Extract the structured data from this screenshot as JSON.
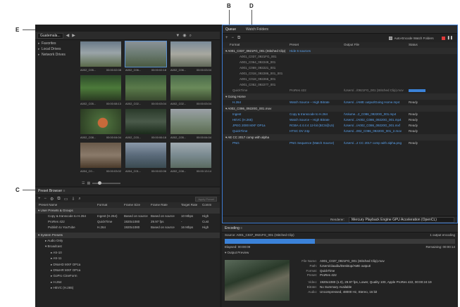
{
  "callouts": {
    "b": "B",
    "c": "C",
    "d": "D",
    "e": "E"
  },
  "media_browser": {
    "location": "Guatemala...",
    "tree": [
      "Favorites",
      "Local Drives",
      "Network Drives"
    ],
    "thumbs": [
      {
        "name": "A002_C05...",
        "tc": "00:00:02:08"
      },
      {
        "name": "A002_C06...",
        "tc": "00:00:02:18",
        "selected": true
      },
      {
        "name": "A002_C06...",
        "tc": "00:00:03:04"
      },
      {
        "name": "A002_C05...",
        "tc": "00:00:08:13"
      },
      {
        "name": "A002_C02...",
        "tc": "00:00:03:04"
      },
      {
        "name": "A002_C02...",
        "tc": "00:00:03:04"
      },
      {
        "name": "A002_C08...",
        "tc": "00:00:04:04"
      },
      {
        "name": "A002_C03...",
        "tc": "00:00:06:18"
      },
      {
        "name": "A002_C05...",
        "tc": "00:00:04:04"
      },
      {
        "name": "A004_C0...",
        "tc": "00:00:03:02"
      },
      {
        "name": "A004_C01...",
        "tc": "00:00:02:06"
      },
      {
        "name": "A002_C08...",
        "tc": "00:00:13:14"
      }
    ]
  },
  "preset_browser": {
    "title": "Preset Browser",
    "apply": "Apply Preset",
    "columns": [
      "Preset Name",
      "Format",
      "Frame Size",
      "Frame Rate",
      "Target Rate",
      "Comm"
    ],
    "user_group": "User Presets & Groups",
    "user_presets": [
      [
        "Copy & transcode to H.264",
        "Ingest (H.264)",
        "Based on source",
        "Based on source",
        "10 Mbps",
        "High"
      ],
      [
        "ProRes 422",
        "QuickTime",
        "1920x1080",
        "29.97 fps",
        "-",
        "Cust"
      ],
      [
        "Publish to YouTube",
        "H.264",
        "1920x1080",
        "Based on source",
        "16 Mbps",
        "High"
      ]
    ],
    "system_group": "System Presets",
    "system_items": [
      {
        "label": "Audio Only",
        "sub": false
      },
      {
        "label": "Broadcast",
        "sub": false
      },
      {
        "label": "AS-10",
        "sub": true
      },
      {
        "label": "AS-11",
        "sub": true
      },
      {
        "label": "DNxHD MXF OP1a",
        "sub": true
      },
      {
        "label": "DNxHR MXF OP1a",
        "sub": true
      },
      {
        "label": "GoPro CineForm",
        "sub": true
      },
      {
        "label": "H.264",
        "sub": true
      },
      {
        "label": "HEVC (H.265)",
        "sub": true
      }
    ]
  },
  "queue": {
    "tabs": [
      "Queue",
      "Watch Folders"
    ],
    "auto_encode": "Auto-Encode Watch Folders",
    "columns": [
      "Format",
      "Preset",
      "Output File",
      "Status"
    ],
    "group1": {
      "name": "A001_C037_0921FG_001 (Stitched Clip)",
      "preset": "Hide 6 sources"
    },
    "sources": [
      "A001_C037_0921FG_001",
      "A001_C064_092249_001",
      "A001_C069_092221_001",
      "A001_C018_092286_001_001",
      "A001_C018_092266_001",
      "A001_C052_092277_001"
    ],
    "group1_row": {
      "format": "QuickTime",
      "preset": "ProRes 422",
      "output": "/Users/.../0921FG_001 (Stitched Clip).mov"
    },
    "group2": {
      "name": "Going Home"
    },
    "group2_rows": [
      {
        "format": "H.264",
        "preset": "Watch Source – High Bitrate",
        "output": "/Users/.../AME output/Going Home.mp4",
        "status": "Ready"
      }
    ],
    "group3": {
      "name": "A002_C086_09220G_001.mov"
    },
    "group3_rows": [
      {
        "format": "Ingest",
        "preset": "Copy & transcode to H.264",
        "output": "/Volume...2_C086_09220G_001.mp4",
        "status": "Ready"
      },
      {
        "format": "HEVC (H.265)",
        "preset": "Watch Source – High Bitrate",
        "output": "/Users/.../A002_C086_09220G_001.mp4",
        "status": "Ready"
      },
      {
        "format": "JPEG 2000 MXF OP1a",
        "preset": "RGBA 4:4:4:4 12-bit (BCS@L5)",
        "output": "/Users/.../A002_C086_09220G_001.mxf",
        "status": "Ready"
      },
      {
        "format": "QuickTime",
        "preset": "HTSC DV 24p",
        "output": "/Users/...002_C086_09220G_001_2.mov",
        "status": "Ready"
      }
    ],
    "group4": {
      "name": "AE CC 2017 comp with alpha"
    },
    "group4_rows": [
      {
        "format": "PNG",
        "preset": "PNG Sequence (Match Source)",
        "output": "/Users/...2 CC 2017 comp with alpha.png",
        "status": "Ready"
      }
    ],
    "renderer_label": "Renderer:",
    "renderer_value": "Mercury Playback Engine GPU Acceleration (OpenCL)"
  },
  "encoding": {
    "title": "Encoding",
    "source": "Source: A001_C037_0921FG_001 (Stitched Clip)",
    "count": "1 output encoding",
    "elapsed": "Elapsed: 00:00:09",
    "remaining": "Remaining: 00:00:14",
    "progress": 0.39,
    "output_preview": "Output Preview",
    "meta": [
      {
        "k": "File Name:",
        "v": "A001_C037_0921FG_001 (Stitched Clip).mov"
      },
      {
        "k": "Path:",
        "v": "/Users/claudiu/Desktop/AME output/"
      },
      {
        "k": "Format:",
        "v": "QuickTime"
      },
      {
        "k": "Preset:",
        "v": "ProRes 422"
      },
      {
        "k": "",
        "v": ""
      },
      {
        "k": "Video:",
        "v": "1920x1080 (1.0), 29.97 fps, Lower, Quality 100, Apple ProRes 422, 00:00:24:19"
      },
      {
        "k": "Bitrate:",
        "v": "No Summary Available"
      },
      {
        "k": "Audio:",
        "v": "Uncompressed, 48000 Hz, Stereo, 16 bit"
      }
    ]
  }
}
